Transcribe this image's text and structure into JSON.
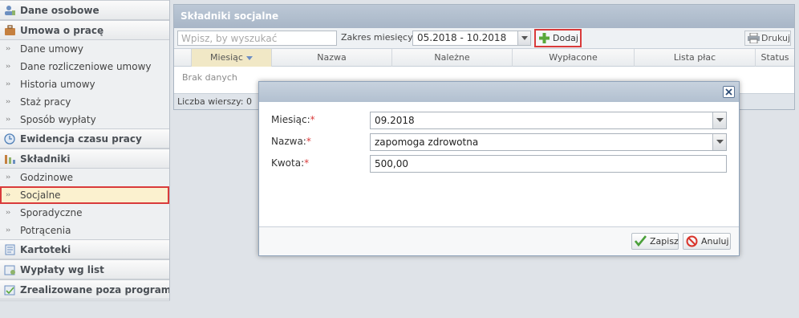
{
  "sidebar": {
    "sections": [
      {
        "label": "Dane osobowe",
        "icon": "person-icon"
      },
      {
        "label": "Umowa o pracę",
        "icon": "briefcase-icon"
      },
      {
        "label": "Ewidencja czasu pracy",
        "icon": "clock-icon"
      },
      {
        "label": "Składniki",
        "icon": "components-icon"
      },
      {
        "label": "Kartoteki",
        "icon": "card-file-icon"
      },
      {
        "label": "Wypłaty wg list",
        "icon": "payout-list-icon"
      },
      {
        "label": "Zrealizowane poza programem",
        "icon": "external-realized-icon"
      }
    ],
    "umowa_items": [
      "Dane umowy",
      "Dane rozliczeniowe umowy",
      "Historia umowy",
      "Staż pracy",
      "Sposób wypłaty"
    ],
    "skladniki_items": [
      "Godzinowe",
      "Socjalne",
      "Sporadyczne",
      "Potrącenia"
    ],
    "active_item": "Socjalne"
  },
  "panel": {
    "title": "Składniki socjalne",
    "search_placeholder": "Wpisz, by wyszukać",
    "range_label": "Zakres miesięcy:",
    "range_value": "05.2018 - 10.2018",
    "add_label": "Dodaj",
    "print_label": "Drukuj",
    "columns": [
      "Miesiąc",
      "Nazwa",
      "Należne",
      "Wypłacone",
      "Lista płac",
      "Status"
    ],
    "sorted_column": "Miesiąc",
    "no_data": "Brak danych",
    "row_count_label": "Liczba wierszy: 0"
  },
  "modal": {
    "fields": [
      {
        "label": "Miesiąc:",
        "value": "09.2018",
        "type": "select"
      },
      {
        "label": "Nazwa:",
        "value": "zapomoga zdrowotna",
        "type": "select"
      },
      {
        "label": "Kwota:",
        "value": "500,00",
        "type": "text"
      }
    ],
    "required_mark": "*",
    "save_label": "Zapisz",
    "cancel_label": "Anuluj"
  },
  "colors": {
    "highlight_border": "#d93b3b",
    "active_bg": "#fbf1cf",
    "header_blue": "#b2c0d0",
    "add_icon_green": "#5aa83a"
  }
}
